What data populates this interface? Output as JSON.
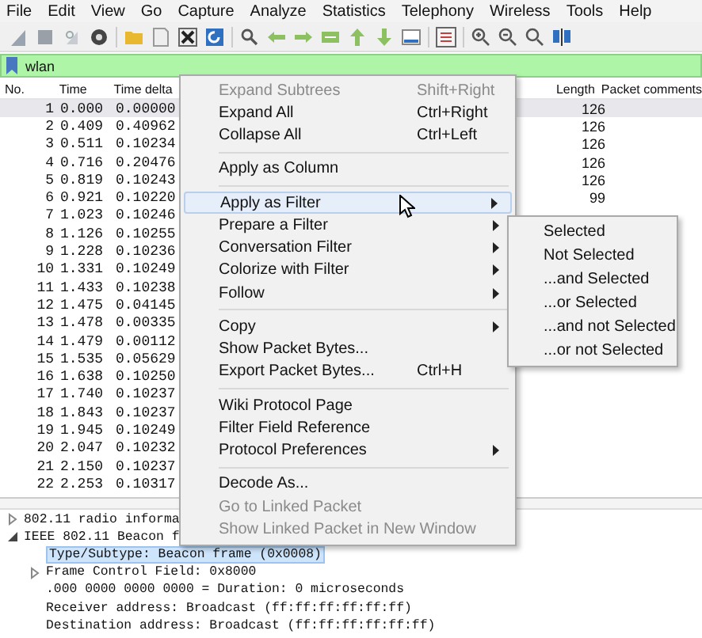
{
  "menubar": [
    "File",
    "Edit",
    "View",
    "Go",
    "Capture",
    "Analyze",
    "Statistics",
    "Telephony",
    "Wireless",
    "Tools",
    "Help"
  ],
  "filter": {
    "value": "wlan"
  },
  "packet_list": {
    "columns": [
      "No.",
      "Time",
      "Time delta",
      "Length",
      "Packet comments"
    ],
    "rows": [
      {
        "no": "1",
        "time": "0.000",
        "delta": "0.00000",
        "length": "126",
        "selected": true
      },
      {
        "no": "2",
        "time": "0.409",
        "delta": "0.40962",
        "length": "126",
        "selected": false
      },
      {
        "no": "3",
        "time": "0.511",
        "delta": "0.10234",
        "length": "126",
        "selected": false
      },
      {
        "no": "4",
        "time": "0.716",
        "delta": "0.20476",
        "length": "126",
        "selected": false
      },
      {
        "no": "5",
        "time": "0.819",
        "delta": "0.10243",
        "length": "126",
        "selected": false
      },
      {
        "no": "6",
        "time": "0.921",
        "delta": "0.10220",
        "length": "99",
        "selected": false
      },
      {
        "no": "7",
        "time": "1.023",
        "delta": "0.10246",
        "selected": false
      },
      {
        "no": "8",
        "time": "1.126",
        "delta": "0.10255",
        "selected": false
      },
      {
        "no": "9",
        "time": "1.228",
        "delta": "0.10236",
        "selected": false
      },
      {
        "no": "10",
        "time": "1.331",
        "delta": "0.10249",
        "selected": false
      },
      {
        "no": "11",
        "time": "1.433",
        "delta": "0.10238",
        "selected": false
      },
      {
        "no": "12",
        "time": "1.475",
        "delta": "0.04145",
        "selected": false
      },
      {
        "no": "13",
        "time": "1.478",
        "delta": "0.00335",
        "selected": false
      },
      {
        "no": "14",
        "time": "1.479",
        "delta": "0.00112",
        "selected": false
      },
      {
        "no": "15",
        "time": "1.535",
        "delta": "0.05629",
        "selected": false
      },
      {
        "no": "16",
        "time": "1.638",
        "delta": "0.10250",
        "selected": false
      },
      {
        "no": "17",
        "time": "1.740",
        "delta": "0.10237",
        "selected": false
      },
      {
        "no": "18",
        "time": "1.843",
        "delta": "0.10237",
        "selected": false
      },
      {
        "no": "19",
        "time": "1.945",
        "delta": "0.10249",
        "selected": false
      },
      {
        "no": "20",
        "time": "2.047",
        "delta": "0.10232",
        "selected": false
      },
      {
        "no": "21",
        "time": "2.150",
        "delta": "0.10237",
        "selected": false
      },
      {
        "no": "22",
        "time": "2.253",
        "delta": "0.10317",
        "selected": false
      }
    ]
  },
  "details": [
    {
      "text": "802.11 radio informa",
      "expanded": false,
      "selected": false
    },
    {
      "text": "IEEE 802.11 Beacon f",
      "expanded": true,
      "selected": false,
      "children": [
        {
          "text": "Type/Subtype: Beacon frame (0x0008)",
          "selected": true
        },
        {
          "text": "Frame Control Field: 0x8000",
          "expanded": false,
          "selected": false
        },
        {
          "text": ".000 0000 0000 0000 = Duration: 0 microseconds",
          "selected": false
        },
        {
          "text": "Receiver address: Broadcast (ff:ff:ff:ff:ff:ff)",
          "selected": false
        },
        {
          "text": "Destination address: Broadcast (ff:ff:ff:ff:ff:ff)",
          "selected": false
        }
      ]
    }
  ],
  "context_menu": {
    "items": [
      {
        "kind": "item",
        "label": "Expand Subtrees",
        "shortcut": "Shift+Right",
        "disabled": true,
        "submenu": false,
        "selected": false
      },
      {
        "kind": "item",
        "label": "Expand All",
        "shortcut": "Ctrl+Right",
        "disabled": false,
        "submenu": false,
        "selected": false
      },
      {
        "kind": "item",
        "label": "Collapse All",
        "shortcut": "Ctrl+Left",
        "disabled": false,
        "submenu": false,
        "selected": false
      },
      {
        "kind": "separator"
      },
      {
        "kind": "item",
        "label": "Apply as Column",
        "disabled": false,
        "submenu": false,
        "selected": false
      },
      {
        "kind": "separator"
      },
      {
        "kind": "item",
        "label": "Apply as Filter",
        "disabled": false,
        "submenu": true,
        "selected": true
      },
      {
        "kind": "item",
        "label": "Prepare a Filter",
        "disabled": false,
        "submenu": true,
        "selected": false
      },
      {
        "kind": "item",
        "label": "Conversation Filter",
        "disabled": false,
        "submenu": true,
        "selected": false
      },
      {
        "kind": "item",
        "label": "Colorize with Filter",
        "disabled": false,
        "submenu": true,
        "selected": false
      },
      {
        "kind": "item",
        "label": "Follow",
        "disabled": false,
        "submenu": true,
        "selected": false
      },
      {
        "kind": "separator"
      },
      {
        "kind": "item",
        "label": "Copy",
        "disabled": false,
        "submenu": true,
        "selected": false
      },
      {
        "kind": "item",
        "label": "Show Packet Bytes...",
        "disabled": false,
        "submenu": false,
        "selected": false
      },
      {
        "kind": "item",
        "label": "Export Packet Bytes...",
        "shortcut": "Ctrl+H",
        "disabled": false,
        "submenu": false,
        "selected": false
      },
      {
        "kind": "separator"
      },
      {
        "kind": "item",
        "label": "Wiki Protocol Page",
        "disabled": false,
        "submenu": false,
        "selected": false
      },
      {
        "kind": "item",
        "label": "Filter Field Reference",
        "disabled": false,
        "submenu": false,
        "selected": false
      },
      {
        "kind": "item",
        "label": "Protocol Preferences",
        "disabled": false,
        "submenu": true,
        "selected": false
      },
      {
        "kind": "separator"
      },
      {
        "kind": "item",
        "label": "Decode As...",
        "disabled": false,
        "submenu": false,
        "selected": false
      },
      {
        "kind": "item",
        "label": "Go to Linked Packet",
        "disabled": true,
        "submenu": false,
        "selected": false
      },
      {
        "kind": "item",
        "label": "Show Linked Packet in New Window",
        "disabled": true,
        "submenu": false,
        "selected": false
      }
    ]
  },
  "submenu": {
    "items": [
      {
        "label": "Selected"
      },
      {
        "label": "Not Selected"
      },
      {
        "label": "...and Selected"
      },
      {
        "label": "...or Selected"
      },
      {
        "label": "...and not Selected"
      },
      {
        "label": "...or not Selected"
      }
    ]
  }
}
